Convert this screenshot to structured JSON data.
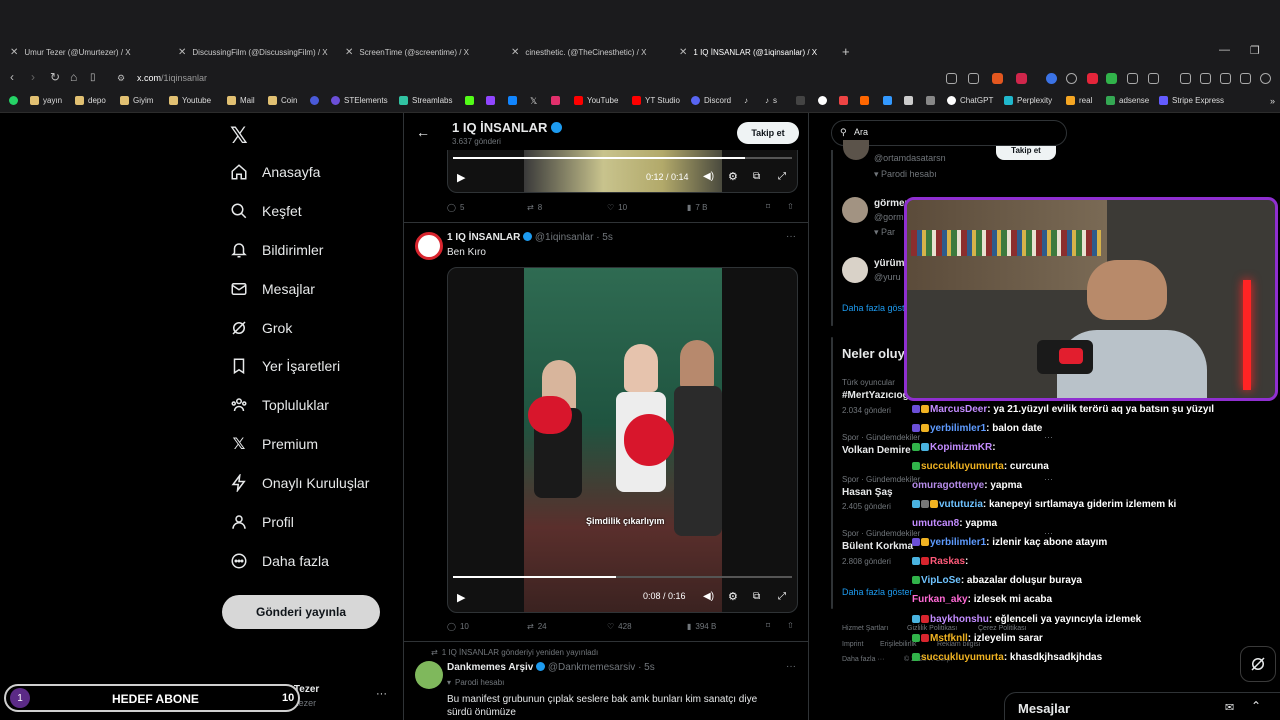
{
  "browser": {
    "tabs": [
      {
        "label": "Umur Tezer (@Umurtezer) / X"
      },
      {
        "label": "DiscussingFilm (@DiscussingFilm) / X"
      },
      {
        "label": "ScreenTime (@screentime) / X"
      },
      {
        "label": "cinesthetic. (@TheCinesthetic) / X"
      },
      {
        "label": "1 IQ İNSANLAR (@1iqinsanlar) / X"
      }
    ],
    "url_host": "x.com",
    "url_path": "/1iqinsanlar",
    "bookmarks": [
      "yayın",
      "depo",
      "Giyim",
      "Youtube",
      "Mail",
      "Coin",
      "STElements",
      "Streamlabs",
      "YouTube",
      "YT Studio",
      "Discord",
      "ChatGPT",
      "Perplexity",
      "real",
      "adsense",
      "Stripe Express"
    ],
    "bookmark_short": [
      "s"
    ]
  },
  "sidebar": {
    "items": [
      {
        "label": "Anasayfa",
        "icon": "home-icon"
      },
      {
        "label": "Keşfet",
        "icon": "search-icon"
      },
      {
        "label": "Bildirimler",
        "icon": "bell-icon"
      },
      {
        "label": "Mesajlar",
        "icon": "mail-icon"
      },
      {
        "label": "Grok",
        "icon": "grok-icon"
      },
      {
        "label": "Yer İşaretleri",
        "icon": "bookmark-icon"
      },
      {
        "label": "Topluluklar",
        "icon": "people-icon"
      },
      {
        "label": "Premium",
        "icon": "x-icon"
      },
      {
        "label": "Onaylı Kuruluşlar",
        "icon": "lightning-icon"
      },
      {
        "label": "Profil",
        "icon": "user-icon"
      },
      {
        "label": "Daha fazla",
        "icon": "more-circle-icon"
      }
    ],
    "post_button": "Gönderi yayınla",
    "account_name": "Umur Tezer",
    "account_handle": "@Umurtezer"
  },
  "overlay_goal": {
    "left_num": "1",
    "label": "HEDEF ABONE",
    "right_num": "10"
  },
  "profile_header": {
    "name": "1 IQ İNSANLAR",
    "posts": "3.637 gönderi",
    "follow": "Takip et"
  },
  "tweets": [
    {
      "video_time": "0:12 / 0:14",
      "video_progress": 0.86,
      "replies": "5",
      "retweets": "8",
      "likes": "10",
      "views": "7 B"
    },
    {
      "author": "1 IQ İNSANLAR",
      "handle": "@1iqinsanlar · 5s",
      "text": "Ben Kıro",
      "caption": "Şimdilik çıkarlıyım",
      "video_time": "0:08 / 0:16",
      "video_progress": 0.48,
      "replies": "10",
      "retweets": "24",
      "likes": "428",
      "views": "394 B"
    },
    {
      "retweeted_by": "1 IQ İNSANLAR gönderiyi yeniden yayınladı",
      "author": "Dankmemes Arşiv",
      "handle": "@Dankmemesarsiv · 5s",
      "badge": "Parodi hesabı",
      "text_line1": "Bu manifest grubunun çıplak seslere bak amk bunları kim sanatçı diye",
      "text_line2": "sürdü önümüze"
    }
  ],
  "right": {
    "search_placeholder": "Ara",
    "who_to_follow": [
      {
        "name": "",
        "handle": "@ortamdasatarsn",
        "badge": "Parodi hesabı",
        "button": "Takip et"
      },
      {
        "name": "görmen",
        "handle": "@gorm",
        "badge": "Par"
      },
      {
        "name": "yürüm",
        "handle": "@yuru",
        "badge": ""
      }
    ],
    "show_more": "Daha fazla göster",
    "trends_title": "Neler oluy",
    "trends": [
      {
        "context": "Türk oyuncular",
        "name": "#MertYazıcıoğl",
        "count": "2.034 gönderi"
      },
      {
        "context": "Spor · Gündemdekiler",
        "name": "Volkan Demire",
        "count": ""
      },
      {
        "context": "Spor · Gündemdekiler",
        "name": "Hasan Şaş",
        "count": "2.405 gönderi"
      },
      {
        "context": "Spor · Gündemdekiler",
        "name": "Bülent Korkma",
        "count": "2.808 gönderi"
      }
    ],
    "trends_more": "Daha fazla göster",
    "footer": [
      "Hizmet Şartları",
      "Gizlilik Politikası",
      "Çerez Politikası",
      "Imprint",
      "Erişilebilirlik",
      "Reklam bilgisi",
      "Daha fazla ···",
      "© 2025 X Corp."
    ]
  },
  "chat": [
    {
      "user": "MarcusDeer",
      "color": "#c38cff",
      "msg": ": ya 21.yüzyıl evilik terörü aq ya batsın şu yüzyıl"
    },
    {
      "user": "yerbilimler1",
      "color": "#5e9bff",
      "msg": ": balon date"
    },
    {
      "user": "KopimizmKR",
      "color": "#c38cff",
      "msg": ":"
    },
    {
      "user": "succukluyumurta",
      "color": "#f0b322",
      "msg": ": curcuna"
    },
    {
      "user": "omuragottenye",
      "color": "#b58be8",
      "msg": ": yapma"
    },
    {
      "user": "vututuzia",
      "color": "#6fc3ff",
      "msg": ": kanepeyi sırtlamaya giderim izlemem ki"
    },
    {
      "user": "umutcan8",
      "color": "#c38cff",
      "msg": ": yapma"
    },
    {
      "user": "yerbilimler1",
      "color": "#5e9bff",
      "msg": ": izlenir kaç abone atayım"
    },
    {
      "user": "Raskas",
      "color": "#ff5a7a",
      "msg": ":"
    },
    {
      "user": "VipLoSe",
      "color": "#6fc3ff",
      "msg": ": abazalar doluşur buraya"
    },
    {
      "user": "Furkan_aky",
      "color": "#ff6ad5",
      "msg": ": izlesek mi acaba"
    },
    {
      "user": "baykhonshu",
      "color": "#c38cff",
      "msg": ": eğlenceli ya yayıncıyla izlemek"
    },
    {
      "user": "Mstfknll",
      "color": "#f0b322",
      "msg": ": izleyelim sarar"
    },
    {
      "user": "succukluyumurta",
      "color": "#f0b322",
      "msg": ": khasdkjhsadkjhdas"
    }
  ],
  "messages_bar": "Mesajlar",
  "colors": {
    "accent": "#1d9bf0",
    "webcam_border": "#8f2fd0"
  }
}
